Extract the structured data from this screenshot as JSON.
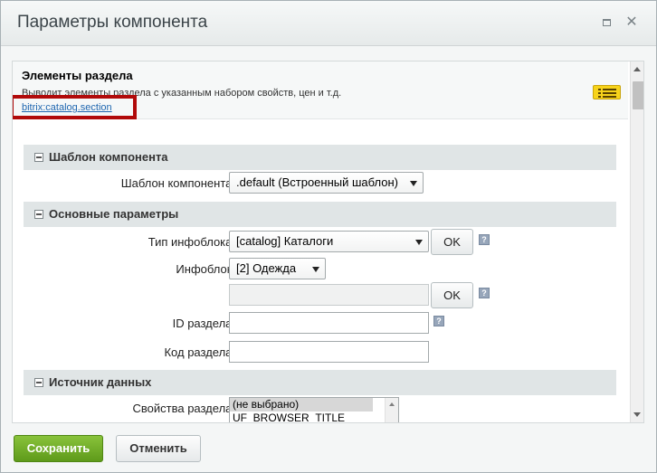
{
  "window": {
    "title": "Параметры компонента",
    "maximize_icon": "maximize-icon",
    "close_symbol": "✕"
  },
  "component": {
    "name": "Элементы раздела",
    "description": "Выводит элементы раздела с указанным набором свойств, цен и т.д.",
    "link": "bitrix:catalog.section"
  },
  "sections": [
    {
      "title": "Шаблон компонента",
      "fields": [
        {
          "label": "Шаблон компонента:",
          "value": ".default (Встроенный шаблон)"
        }
      ]
    },
    {
      "title": "Основные параметры",
      "fields": [
        {
          "label": "Тип инфоблока:",
          "value": "[catalog] Каталоги",
          "button": "OK"
        },
        {
          "label": "Инфоблок:",
          "value": "[2] Одежда",
          "extra_button": "OK"
        },
        {
          "label": "ID раздела:",
          "value": ""
        },
        {
          "label": "Код раздела:",
          "value": ""
        }
      ]
    },
    {
      "title": "Источник данных",
      "fields": [
        {
          "label": "Свойства раздела:",
          "options": [
            "(не выбрано)",
            "UF_BROWSER_TITLE"
          ]
        }
      ]
    }
  ],
  "help_symbol": "?",
  "footer": {
    "save": "Сохранить",
    "cancel": "Отменить"
  },
  "colors": {
    "highlight": "#b10a0a",
    "save_button": "#6ba625",
    "link": "#2067b0"
  }
}
